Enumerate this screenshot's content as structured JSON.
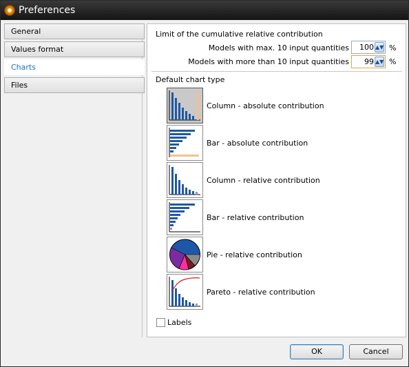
{
  "window": {
    "title": "Preferences"
  },
  "nav": {
    "items": [
      {
        "label": "General"
      },
      {
        "label": "Values format"
      },
      {
        "label": "Charts"
      },
      {
        "label": "Files"
      }
    ]
  },
  "limit": {
    "heading": "Limit of the cumulative relative contribution",
    "row1_label": "Models with max. 10 input quantities",
    "row1_value": "100",
    "row2_label": "Models with more than 10 input quantities",
    "row2_value": "99",
    "unit": "%"
  },
  "chart_type": {
    "heading": "Default chart type",
    "options": [
      {
        "label": "Column - absolute contribution",
        "icon": "column-chart-icon"
      },
      {
        "label": "Bar - absolute contribution",
        "icon": "bar-chart-icon"
      },
      {
        "label": "Column - relative contribution",
        "icon": "column-chart-icon"
      },
      {
        "label": "Bar - relative contribution",
        "icon": "bar-chart-icon"
      },
      {
        "label": "Pie - relative contribution",
        "icon": "pie-chart-icon"
      },
      {
        "label": "Pareto - relative contribution",
        "icon": "pareto-chart-icon"
      }
    ],
    "selected_index": 0
  },
  "labels_checkbox": {
    "label": "Labels",
    "checked": false
  },
  "buttons": {
    "ok": "OK",
    "cancel": "Cancel"
  },
  "colors": {
    "accent": "#1f6fbf",
    "bar_blue": "#1f57a8",
    "limit_line": "#f5c08a",
    "pareto_line": "#d02020"
  }
}
